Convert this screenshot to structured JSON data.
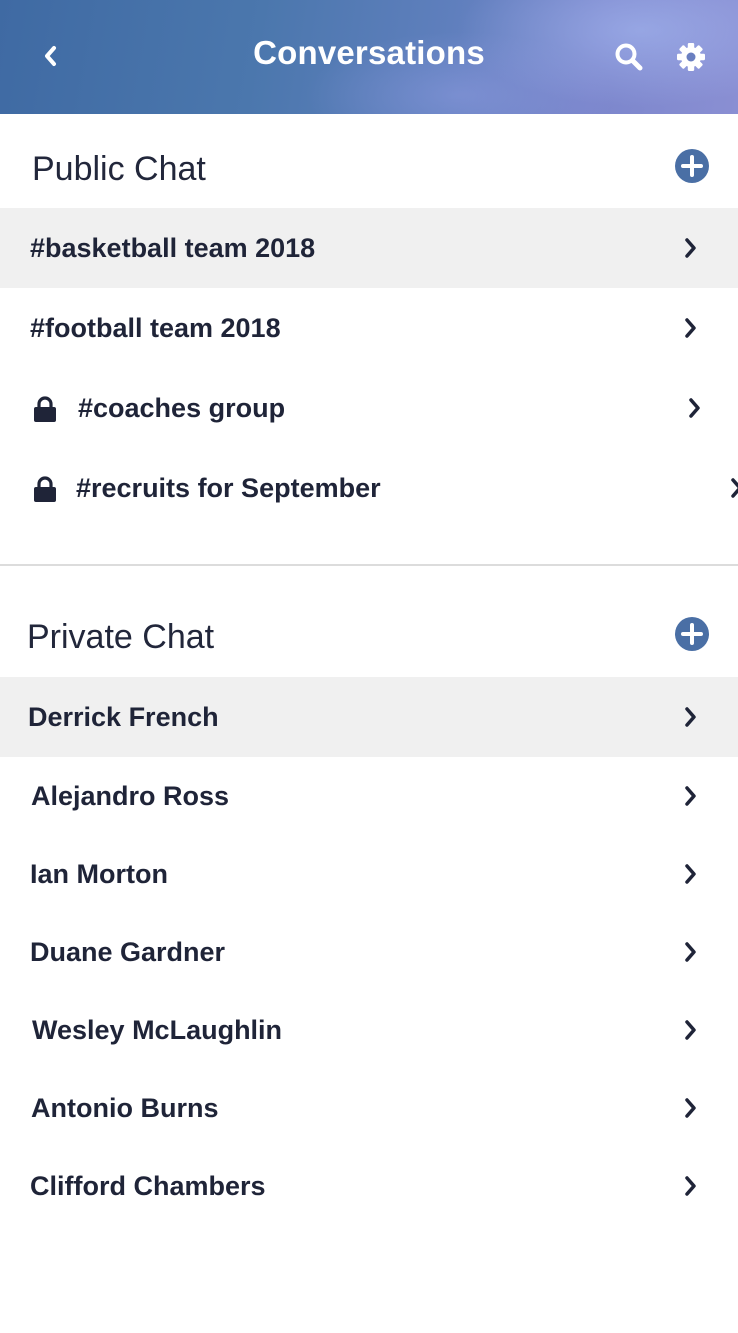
{
  "header": {
    "title": "Conversations",
    "back_icon": "back-chevron-icon",
    "search_icon": "search-icon",
    "settings_icon": "gear-icon",
    "colors": {
      "gradient_start": "#3f6aa3",
      "gradient_end": "#8a8fd3",
      "text": "#ffffff"
    }
  },
  "public_chat": {
    "title": "Public Chat",
    "add_icon": "plus-circle-icon",
    "items": [
      {
        "label": "#basketball team 2018",
        "locked": false,
        "highlighted": true
      },
      {
        "label": "#football team 2018",
        "locked": false,
        "highlighted": false
      },
      {
        "label": "#coaches group",
        "locked": true,
        "highlighted": false
      },
      {
        "label": "#recruits for September",
        "locked": true,
        "highlighted": false
      }
    ]
  },
  "private_chat": {
    "title": "Private Chat",
    "add_icon": "plus-circle-icon",
    "items": [
      {
        "label": "Derrick French",
        "highlighted": true
      },
      {
        "label": "Alejandro Ross",
        "highlighted": false
      },
      {
        "label": "Ian Morton",
        "highlighted": false
      },
      {
        "label": "Duane Gardner",
        "highlighted": false
      },
      {
        "label": "Wesley McLaughlin",
        "highlighted": false
      },
      {
        "label": "Antonio Burns",
        "highlighted": false
      },
      {
        "label": "Clifford Chambers",
        "highlighted": false
      }
    ]
  },
  "colors": {
    "accent": "#4a6fa5",
    "row_highlight": "#f0f0f0",
    "text": "#1f2438",
    "divider": "#dcdcdc"
  }
}
